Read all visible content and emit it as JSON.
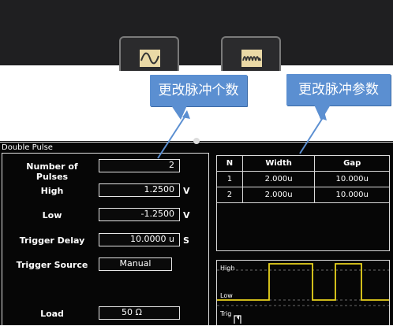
{
  "toolbar": {
    "buttons": [
      {
        "icon": "sine-wave-icon"
      },
      {
        "icon": "pulse-train-icon"
      }
    ]
  },
  "callouts": {
    "num_pulses": "更改脉冲个数",
    "pulse_params": "更改脉冲参数"
  },
  "panel": {
    "title": "Double Pulse",
    "fields": {
      "num_pulses": {
        "label": "Number of Pulses",
        "value": "2"
      },
      "high": {
        "label": "High",
        "value": "1.2500",
        "unit": "V"
      },
      "low": {
        "label": "Low",
        "value": "-1.2500",
        "unit": "V"
      },
      "trigger_delay": {
        "label": "Trigger Delay",
        "value": "10.0000 u",
        "unit": "S"
      },
      "trigger_source": {
        "label": "Trigger Source",
        "value": "Manual"
      },
      "load": {
        "label": "Load",
        "value": "50 Ω"
      }
    }
  },
  "pulse_table": {
    "headers": [
      "N",
      "Width",
      "Gap"
    ],
    "rows": [
      [
        "1",
        "2.000u",
        "10.000u"
      ],
      [
        "2",
        "2.000u",
        "10.000u"
      ]
    ]
  },
  "preview": {
    "high_label": "High",
    "low_label": "Low",
    "trig_label": "Trig"
  },
  "colors": {
    "callout": "#5b8fd1",
    "waveform": "#e8d21c",
    "panel_bg": "#060606",
    "topbar_bg": "#1f1f21"
  }
}
